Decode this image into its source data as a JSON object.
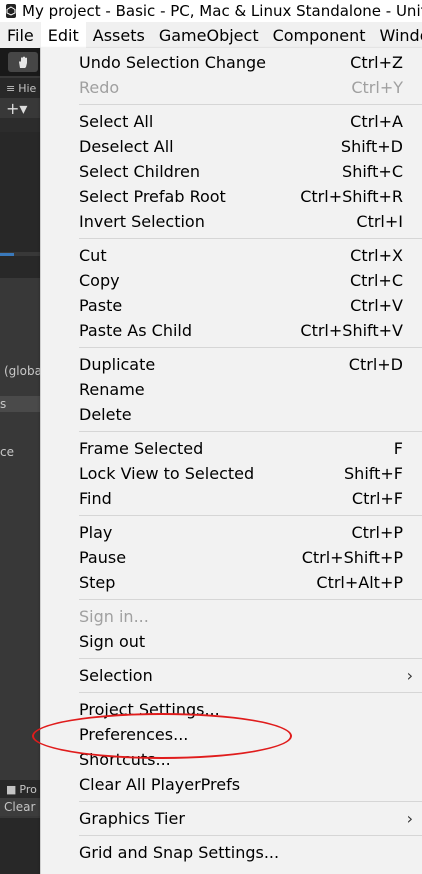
{
  "window": {
    "title": "My project - Basic - PC, Mac & Linux Standalone - Unity"
  },
  "menubar": {
    "items": [
      "File",
      "Edit",
      "Assets",
      "GameObject",
      "Component",
      "Window"
    ]
  },
  "editor_side": {
    "hierarchy_tab": "Hie",
    "plus_label": "+▾",
    "global_text": "(global",
    "s_text": "s",
    "ce_text": "ce",
    "project_tab": "Pro",
    "clear_label": "Clear"
  },
  "edit_menu": {
    "items": [
      {
        "label": "Undo Selection Change",
        "shortcut": "Ctrl+Z",
        "disabled": false
      },
      {
        "label": "Redo",
        "shortcut": "Ctrl+Y",
        "disabled": true
      },
      {
        "label": "Select All",
        "shortcut": "Ctrl+A",
        "disabled": false
      },
      {
        "label": "Deselect All",
        "shortcut": "Shift+D",
        "disabled": false
      },
      {
        "label": "Select Children",
        "shortcut": "Shift+C",
        "disabled": false
      },
      {
        "label": "Select Prefab Root",
        "shortcut": "Ctrl+Shift+R",
        "disabled": false
      },
      {
        "label": "Invert Selection",
        "shortcut": "Ctrl+I",
        "disabled": false
      },
      {
        "label": "Cut",
        "shortcut": "Ctrl+X",
        "disabled": false
      },
      {
        "label": "Copy",
        "shortcut": "Ctrl+C",
        "disabled": false
      },
      {
        "label": "Paste",
        "shortcut": "Ctrl+V",
        "disabled": false
      },
      {
        "label": "Paste As Child",
        "shortcut": "Ctrl+Shift+V",
        "disabled": false
      },
      {
        "label": "Duplicate",
        "shortcut": "Ctrl+D",
        "disabled": false
      },
      {
        "label": "Rename",
        "shortcut": "",
        "disabled": false
      },
      {
        "label": "Delete",
        "shortcut": "",
        "disabled": false
      },
      {
        "label": "Frame Selected",
        "shortcut": "F",
        "disabled": false
      },
      {
        "label": "Lock View to Selected",
        "shortcut": "Shift+F",
        "disabled": false
      },
      {
        "label": "Find",
        "shortcut": "Ctrl+F",
        "disabled": false
      },
      {
        "label": "Play",
        "shortcut": "Ctrl+P",
        "disabled": false
      },
      {
        "label": "Pause",
        "shortcut": "Ctrl+Shift+P",
        "disabled": false
      },
      {
        "label": "Step",
        "shortcut": "Ctrl+Alt+P",
        "disabled": false
      },
      {
        "label": "Sign in...",
        "shortcut": "",
        "disabled": true
      },
      {
        "label": "Sign out",
        "shortcut": "",
        "disabled": false
      },
      {
        "label": "Selection",
        "shortcut": "",
        "disabled": false,
        "submenu": true
      },
      {
        "label": "Project Settings...",
        "shortcut": "",
        "disabled": false
      },
      {
        "label": "Preferences...",
        "shortcut": "",
        "disabled": false,
        "highlighted_annotation": true
      },
      {
        "label": "Shortcuts...",
        "shortcut": "",
        "disabled": false
      },
      {
        "label": "Clear All PlayerPrefs",
        "shortcut": "",
        "disabled": false
      },
      {
        "label": "Graphics Tier",
        "shortcut": "",
        "disabled": false,
        "submenu": true
      },
      {
        "label": "Grid and Snap Settings...",
        "shortcut": "",
        "disabled": false
      }
    ]
  },
  "colors": {
    "annotation_ellipse": "#e01c1c",
    "menu_bg": "#f2f2f2",
    "disabled_text": "#a0a0a0",
    "editor_dark": "#383838",
    "selection_blue": "#3a79bb"
  }
}
